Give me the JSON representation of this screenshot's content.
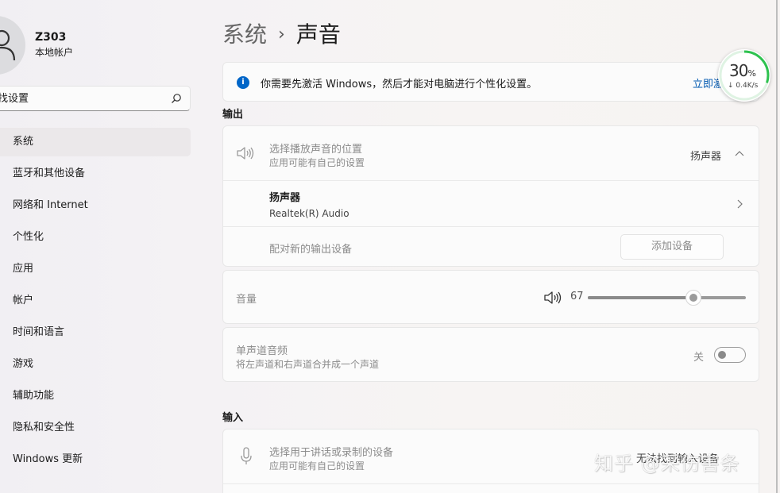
{
  "user": {
    "name": "Z303",
    "account_type": "本地帐户"
  },
  "search": {
    "placeholder": "找设置"
  },
  "nav": [
    {
      "label": "系统",
      "active": true
    },
    {
      "label": "蓝牙和其他设备"
    },
    {
      "label": "网络和 Internet"
    },
    {
      "label": "个性化"
    },
    {
      "label": "应用"
    },
    {
      "label": "帐户"
    },
    {
      "label": "时间和语言"
    },
    {
      "label": "游戏"
    },
    {
      "label": "辅助功能"
    },
    {
      "label": "隐私和安全性"
    },
    {
      "label": "Windows 更新"
    }
  ],
  "breadcrumb": {
    "parent": "系统",
    "separator": "›",
    "current": "声音"
  },
  "banner": {
    "message": "你需要先激活 Windows，然后才能对电脑进行个性化设置。",
    "link": "立即激"
  },
  "output": {
    "title": "输出",
    "choose": {
      "title": "选择播放声音的位置",
      "subtitle": "应用可能有自己的设置",
      "value": "扬声器"
    },
    "device": {
      "name": "扬声器",
      "detail": "Realtek(R) Audio"
    },
    "pair": {
      "label": "配对新的输出设备",
      "button": "添加设备"
    },
    "volume": {
      "label": "音量",
      "value": "67",
      "level": 0.67
    },
    "mono": {
      "title": "单声道音频",
      "subtitle": "将左声道和右声道合并成一个声道",
      "state": "关"
    }
  },
  "input": {
    "title": "输入",
    "choose": {
      "title": "选择用于讲话或录制的设备",
      "subtitle": "应用可能有自己的设置",
      "value": "无法找到输入设备"
    }
  },
  "net_widget": {
    "percent": "30",
    "percent_unit": "%",
    "speed": "↓ 0.4K/s",
    "level": 0.3,
    "accent": "#2ec24f"
  },
  "watermark": "知乎 @采伤害条",
  "colors": {
    "link": "#0058b0",
    "info": "#0066c8"
  }
}
